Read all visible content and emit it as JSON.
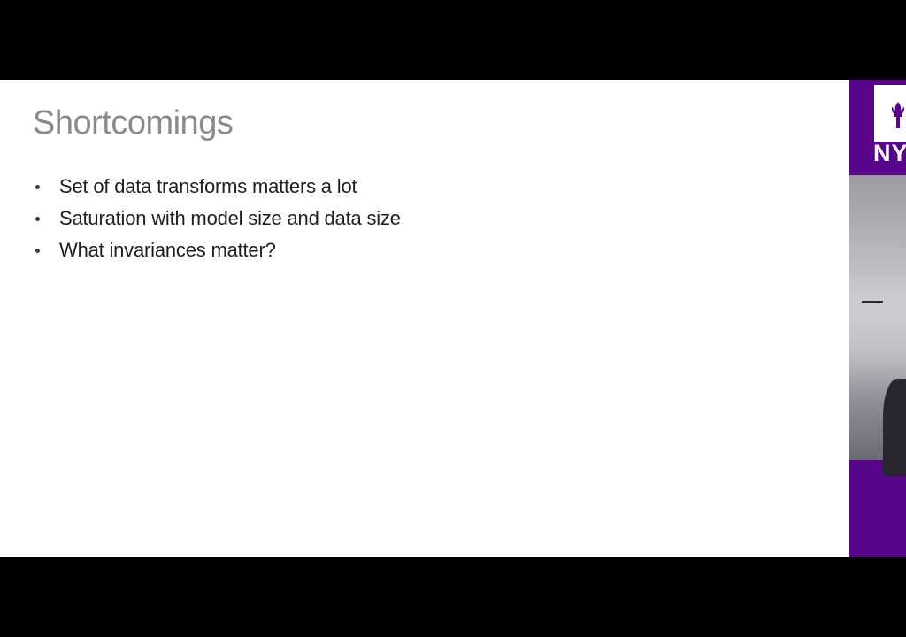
{
  "slide": {
    "title": "Shortcomings",
    "bullets": [
      "Set of data transforms matters a lot",
      "Saturation with model size and data size",
      "What invariances matter?"
    ]
  },
  "sidebar": {
    "logo_text": "NY",
    "brand_color": "#57068c"
  },
  "icons": {
    "logo": "torch-icon"
  }
}
